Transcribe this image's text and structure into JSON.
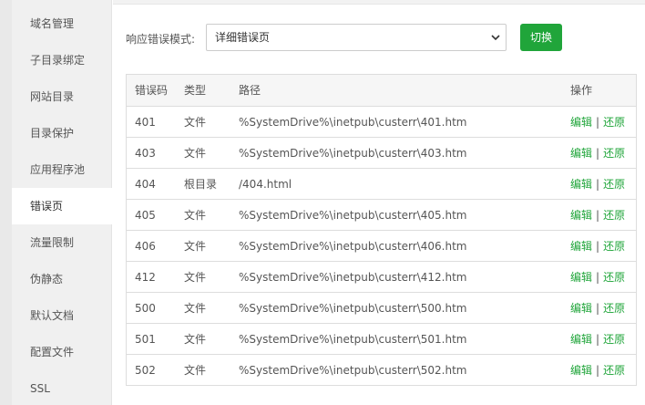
{
  "sidebar": {
    "items": [
      {
        "label": "域名管理",
        "active": false
      },
      {
        "label": "子目录绑定",
        "active": false
      },
      {
        "label": "网站目录",
        "active": false
      },
      {
        "label": "目录保护",
        "active": false
      },
      {
        "label": "应用程序池",
        "active": false
      },
      {
        "label": "错误页",
        "active": true
      },
      {
        "label": "流量限制",
        "active": false
      },
      {
        "label": "伪静态",
        "active": false
      },
      {
        "label": "默认文档",
        "active": false
      },
      {
        "label": "配置文件",
        "active": false
      },
      {
        "label": "SSL",
        "active": false
      }
    ]
  },
  "mode": {
    "label": "响应错误模式:",
    "selected": "详细错误页",
    "switch_label": "切换"
  },
  "table": {
    "headers": {
      "code": "错误码",
      "type": "类型",
      "path": "路径",
      "ops": "操作"
    },
    "rows": [
      {
        "code": "401",
        "type": "文件",
        "path": "%SystemDrive%\\inetpub\\custerr\\401.htm"
      },
      {
        "code": "403",
        "type": "文件",
        "path": "%SystemDrive%\\inetpub\\custerr\\403.htm"
      },
      {
        "code": "404",
        "type": "根目录",
        "path": "/404.html"
      },
      {
        "code": "405",
        "type": "文件",
        "path": "%SystemDrive%\\inetpub\\custerr\\405.htm"
      },
      {
        "code": "406",
        "type": "文件",
        "path": "%SystemDrive%\\inetpub\\custerr\\406.htm"
      },
      {
        "code": "412",
        "type": "文件",
        "path": "%SystemDrive%\\inetpub\\custerr\\412.htm"
      },
      {
        "code": "500",
        "type": "文件",
        "path": "%SystemDrive%\\inetpub\\custerr\\500.htm"
      },
      {
        "code": "501",
        "type": "文件",
        "path": "%SystemDrive%\\inetpub\\custerr\\501.htm"
      },
      {
        "code": "502",
        "type": "文件",
        "path": "%SystemDrive%\\inetpub\\custerr\\502.htm"
      }
    ],
    "edit_label": "编辑",
    "separator": "|",
    "restore_label": "还原"
  },
  "colors": {
    "accent": "#20a53a",
    "sidebar_bg": "#f0f0f0"
  }
}
